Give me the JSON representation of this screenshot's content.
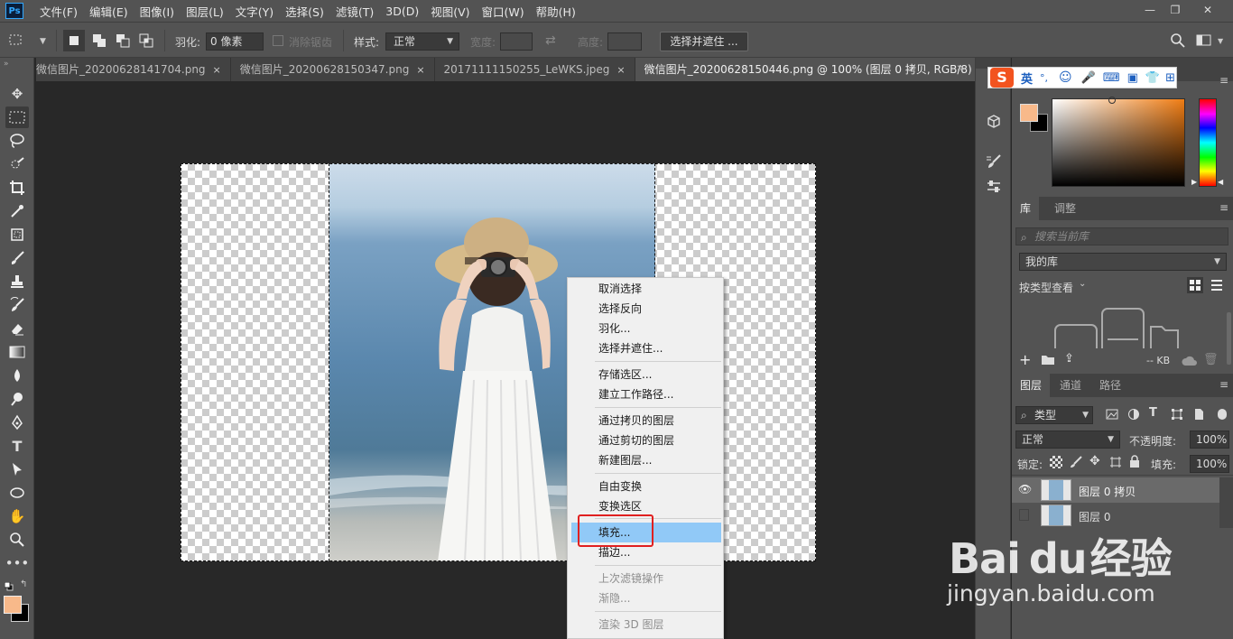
{
  "app": {
    "logo": "Ps"
  },
  "menu": [
    "文件(F)",
    "编辑(E)",
    "图像(I)",
    "图层(L)",
    "文字(Y)",
    "选择(S)",
    "滤镜(T)",
    "3D(D)",
    "视图(V)",
    "窗口(W)",
    "帮助(H)"
  ],
  "window_controls": {
    "minimize": "—",
    "restore": "❐",
    "close": "✕"
  },
  "options": {
    "feather_label": "羽化:",
    "feather_value": "0 像素",
    "antialias_label": "消除锯齿",
    "style_label": "样式:",
    "style_value": "正常",
    "width_label": "宽度:",
    "height_label": "高度:",
    "select_mask_button": "选择并遮住 ..."
  },
  "tabs": [
    {
      "label": "微信图片_20200628141704.png",
      "close": "×"
    },
    {
      "label": "微信图片_20200628150347.png",
      "close": "×"
    },
    {
      "label": "20171111150255_LeWKS.jpeg",
      "close": "×"
    },
    {
      "label": "微信图片_20200628150446.png @ 100% (图层 0 拷贝, RGB/8) *",
      "close": "×"
    }
  ],
  "tabs_overflow": "»",
  "context_menu": [
    {
      "label": "取消选择",
      "state": "normal"
    },
    {
      "label": "选择反向",
      "state": "normal"
    },
    {
      "label": "羽化...",
      "state": "normal"
    },
    {
      "label": "选择并遮住...",
      "state": "normal"
    },
    {
      "label": "存储选区...",
      "state": "normal"
    },
    {
      "label": "建立工作路径...",
      "state": "normal"
    },
    {
      "label": "通过拷贝的图层",
      "state": "normal"
    },
    {
      "label": "通过剪切的图层",
      "state": "normal"
    },
    {
      "label": "新建图层...",
      "state": "normal"
    },
    {
      "label": "自由变换",
      "state": "normal"
    },
    {
      "label": "变换选区",
      "state": "normal"
    },
    {
      "label": "填充...",
      "state": "highlighted"
    },
    {
      "label": "描边...",
      "state": "normal"
    },
    {
      "label": "上次滤镜操作",
      "state": "disabled"
    },
    {
      "label": "渐隐...",
      "state": "disabled"
    },
    {
      "label": "渲染 3D 图层",
      "state": "disabled"
    }
  ],
  "ime": {
    "logo": "S",
    "mode": "英",
    "punct": "°,"
  },
  "color_panel": {
    "foreground": "#f8b98a",
    "background": "#000000",
    "picker_hue": "#f07d14"
  },
  "library_panel": {
    "tabs": [
      "库",
      "调整"
    ],
    "search_placeholder": "搜索当前库",
    "library_name": "我的库",
    "view_by": "按类型查看",
    "size_label": "-- KB"
  },
  "layers_panel": {
    "tabs": [
      "图层",
      "通道",
      "路径"
    ],
    "filter_kind": "类型",
    "blend_mode": "正常",
    "opacity_label": "不透明度:",
    "opacity_value": "100%",
    "lock_label": "锁定:",
    "fill_label": "填充:",
    "fill_value": "100%",
    "layers": [
      {
        "name": "图层 0 拷贝",
        "visible": true,
        "selected": true
      },
      {
        "name": "图层 0",
        "visible": false,
        "selected": false
      }
    ]
  },
  "watermark": {
    "brand": "Bai",
    "paw": "du",
    "suffix": "经验",
    "url": "jingyan.baidu.com"
  }
}
